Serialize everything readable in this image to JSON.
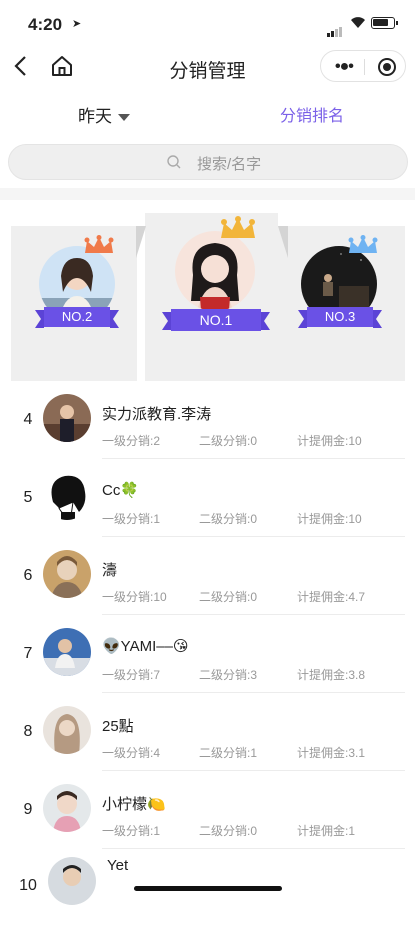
{
  "status_bar": {
    "time": "4:20"
  },
  "nav": {
    "title": "分销管理"
  },
  "tabs": {
    "period": "昨天",
    "ranking": "分销排名"
  },
  "search": {
    "placeholder": "搜索/名字"
  },
  "podium": [
    {
      "rank_label": "NO.2",
      "crown_color": "#f07a4a"
    },
    {
      "rank_label": "NO.1",
      "crown_color": "#f2b53a"
    },
    {
      "rank_label": "NO.3",
      "crown_color": "#6fb3f2"
    }
  ],
  "ranking": [
    {
      "rank": "4",
      "name": "实力派教育.李涛",
      "level1": "一级分销:2",
      "level2": "二级分销:0",
      "commission": "计提佣金:10"
    },
    {
      "rank": "5",
      "name": "Cc🍀",
      "level1": "一级分销:1",
      "level2": "二级分销:0",
      "commission": "计提佣金:10"
    },
    {
      "rank": "6",
      "name": "濤",
      "level1": "一级分销:10",
      "level2": "二级分销:0",
      "commission": "计提佣金:4.7"
    },
    {
      "rank": "7",
      "name": "👽YAMI––😘",
      "level1": "一级分销:7",
      "level2": "二级分销:3",
      "commission": "计提佣金:3.8"
    },
    {
      "rank": "8",
      "name": "25點",
      "level1": "一级分销:4",
      "level2": "二级分销:1",
      "commission": "计提佣金:3.1"
    },
    {
      "rank": "9",
      "name": "小柠檬🍋",
      "level1": "一级分销:1",
      "level2": "二级分销:0",
      "commission": "计提佣金:1"
    },
    {
      "rank": "10",
      "name": "Yet",
      "level1": "",
      "level2": "",
      "commission": ""
    }
  ],
  "colors": {
    "accent": "#7b61e8",
    "ribbon": "#6a51e6"
  }
}
